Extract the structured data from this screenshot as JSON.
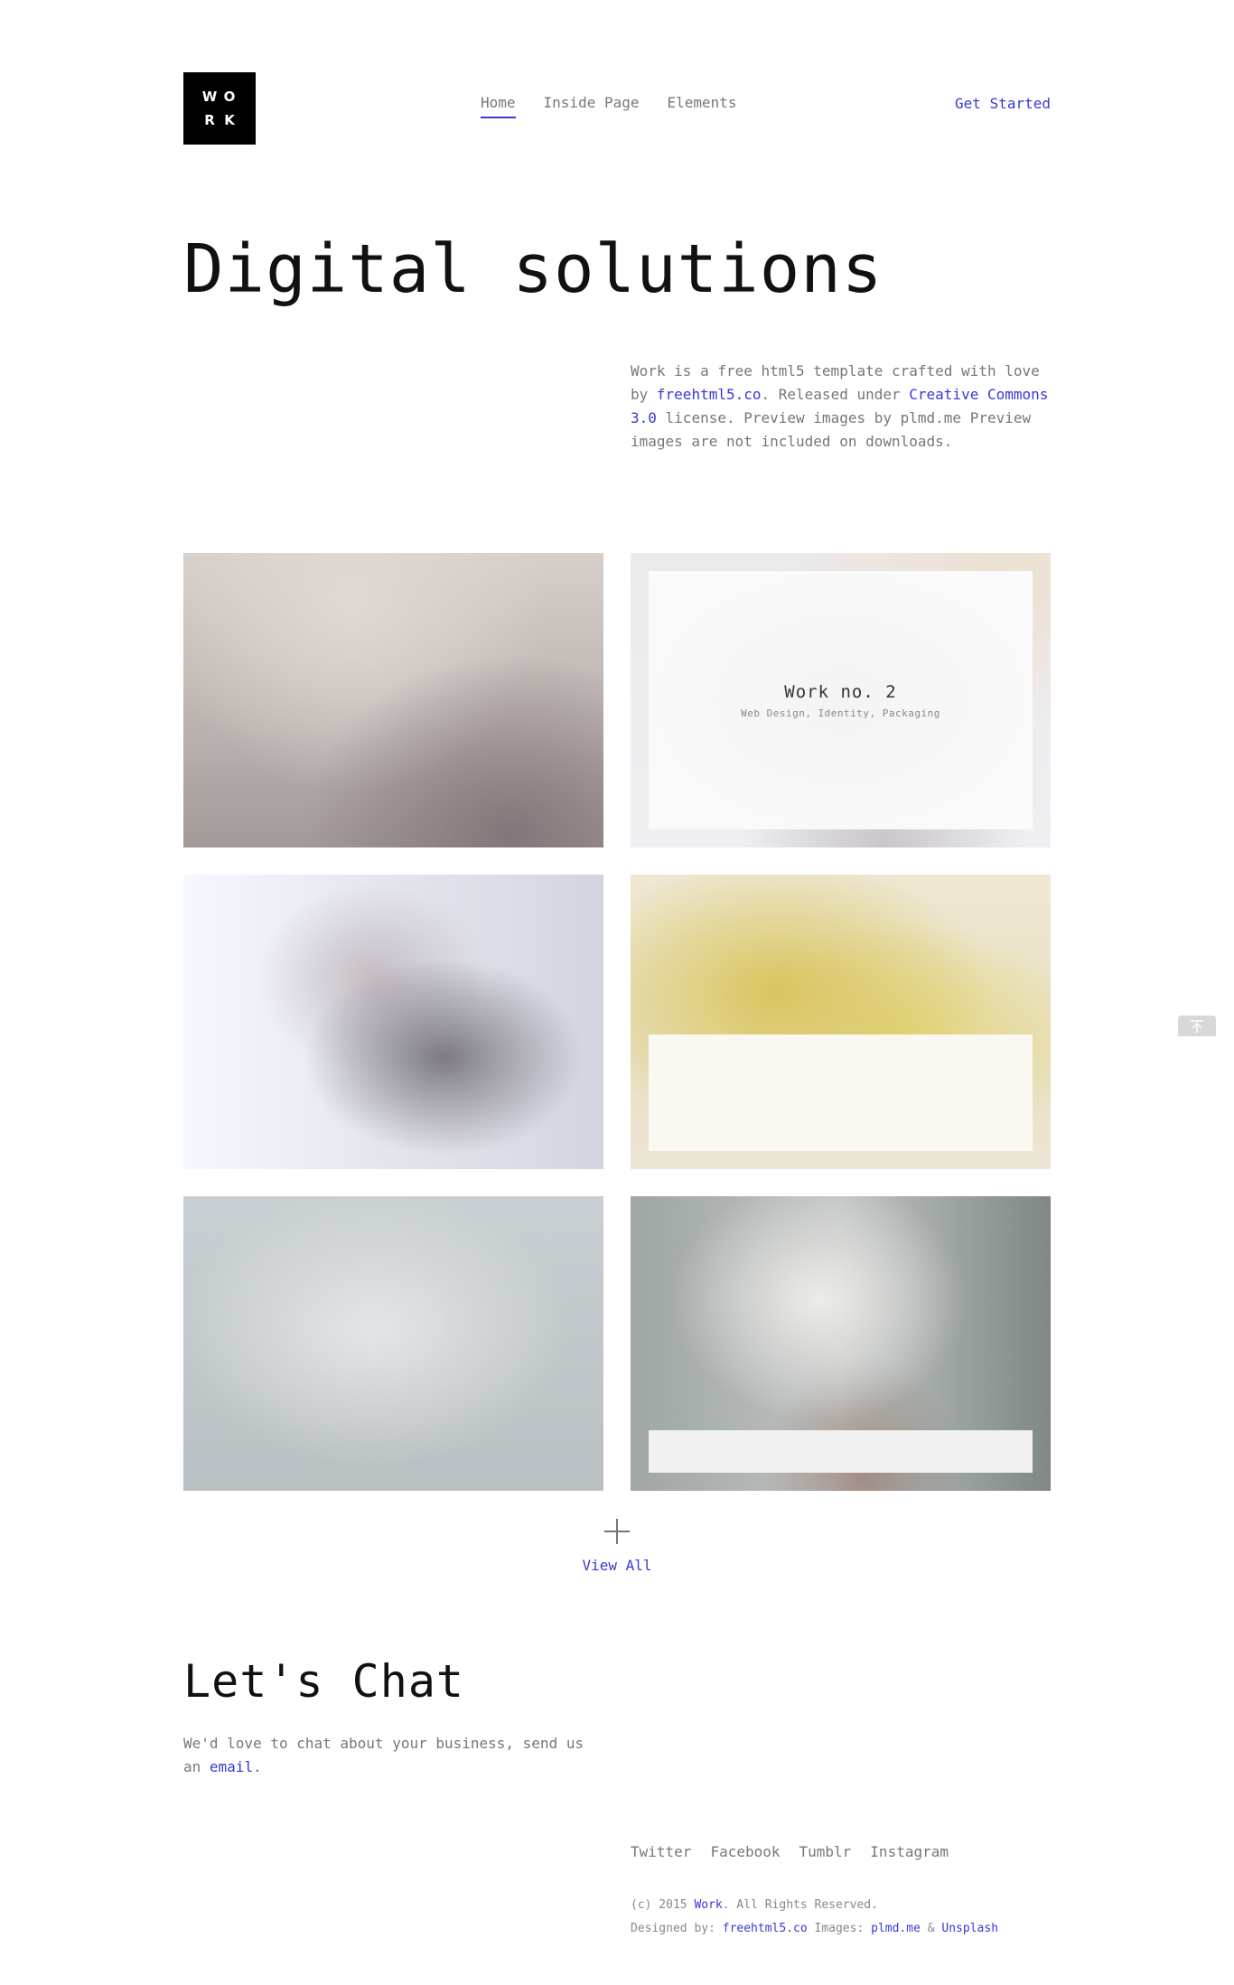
{
  "header": {
    "logo_letters": [
      "W",
      "O",
      "R",
      "K"
    ],
    "nav": [
      {
        "label": "Home",
        "active": true
      },
      {
        "label": "Inside Page",
        "active": false
      },
      {
        "label": "Elements",
        "active": false
      }
    ],
    "cta_label": "Get Started"
  },
  "hero": {
    "title": "Digital solutions",
    "intro": {
      "part1": "Work is a free html5 template crafted with love by ",
      "link1": "freehtml5.co",
      "part2": ". Released under ",
      "link2": "Creative Commons 3.0",
      "part3": " license. Preview images by plmd.me Preview images are not included on downloads."
    }
  },
  "works": {
    "featured": {
      "title": "Work no. 2",
      "subtitle": "Web Design, Identity, Packaging"
    },
    "view_all_label": "View All"
  },
  "chat": {
    "title": "Let's Chat",
    "text_before": "We'd love to chat about your business, send us an ",
    "link": "email",
    "text_after": "."
  },
  "footer": {
    "social": [
      "Twitter",
      "Facebook",
      "Tumblr",
      "Instagram"
    ],
    "copyright": {
      "prefix": "(c) 2015 ",
      "brand": "Work",
      "suffix": ". All Rights Reserved.",
      "designed_label": "Designed by: ",
      "designer": "freehtml5.co",
      "images_label": " Images: ",
      "images_1": "plmd.me",
      "and": " & ",
      "images_2": "Unsplash"
    }
  },
  "icons": {
    "scroll_top": "arrow-up-to-line-icon",
    "view_all": "plus-icon"
  },
  "colors": {
    "accent": "#3a37d6",
    "text": "#777777",
    "heading": "#111111",
    "logo_bg": "#000000"
  }
}
